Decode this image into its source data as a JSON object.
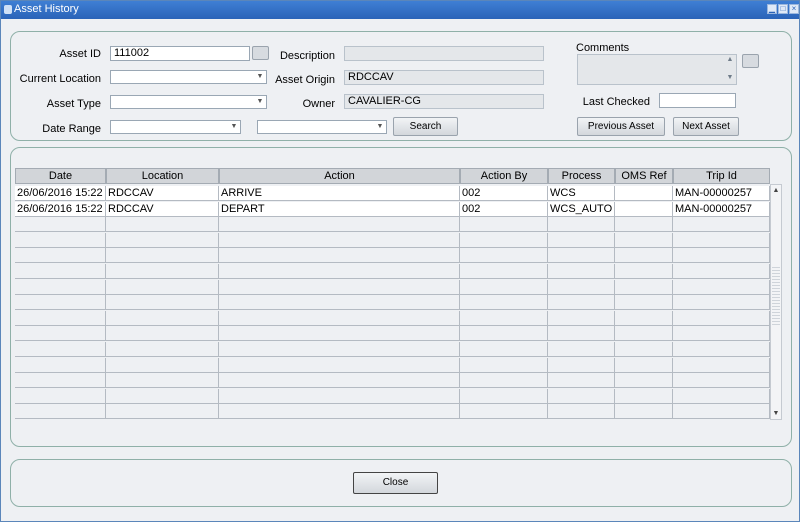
{
  "window": {
    "title": "Asset History"
  },
  "form": {
    "asset_id_label": "Asset ID",
    "asset_id_value": "111002",
    "current_location_label": "Current Location",
    "asset_type_label": "Asset Type",
    "date_range_label": "Date Range",
    "description_label": "Description",
    "description_value": "",
    "asset_origin_label": "Asset Origin",
    "asset_origin_value": "RDCCAV",
    "owner_label": "Owner",
    "owner_value": "CAVALIER-CG",
    "comments_label": "Comments",
    "last_checked_label": "Last Checked",
    "last_checked_value": "",
    "search_label": "Search",
    "previous_asset_label": "Previous Asset",
    "next_asset_label": "Next Asset"
  },
  "grid": {
    "columns": [
      "Date",
      "Location",
      "Action",
      "Action By",
      "Process",
      "OMS Ref",
      "Trip Id"
    ],
    "rows": [
      [
        "26/06/2016 15:22",
        "RDCCAV",
        "ARRIVE",
        "002",
        "WCS",
        "",
        "MAN-00000257"
      ],
      [
        "26/06/2016 15:22",
        "RDCCAV",
        "DEPART",
        "002",
        "WCS_AUTO",
        "",
        "MAN-00000257"
      ]
    ]
  },
  "footer": {
    "close_label": "Close"
  }
}
